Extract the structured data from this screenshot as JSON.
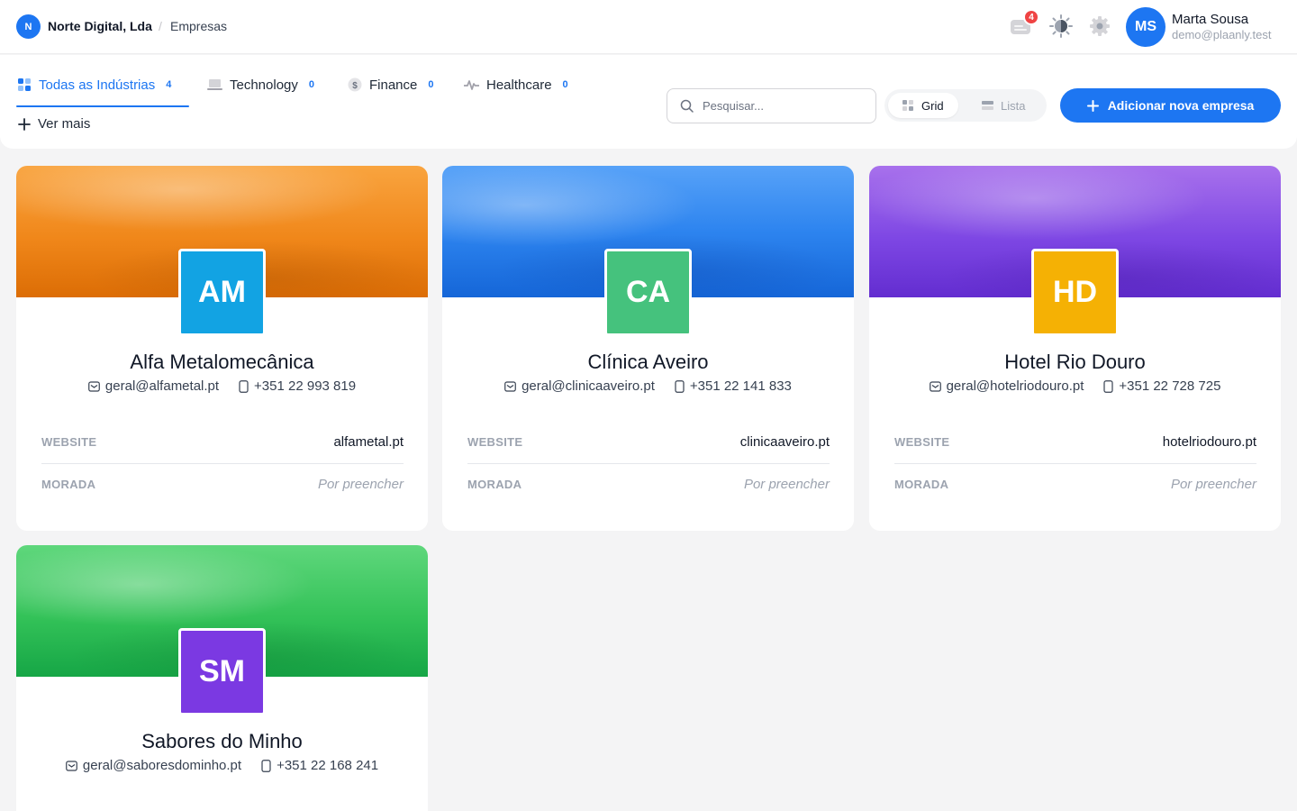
{
  "header": {
    "org_initial": "N",
    "org_name": "Norte Digital, Lda",
    "separator": "/",
    "page": "Empresas",
    "notification_count": "4",
    "user": {
      "initials": "MS",
      "name": "Marta Sousa",
      "email": "demo@plaanly.test"
    }
  },
  "filters": {
    "tabs": [
      {
        "label": "Todas as Indústrias",
        "count": "4",
        "icon": "grid-icon"
      },
      {
        "label": "Technology",
        "count": "0",
        "icon": "laptop-icon"
      },
      {
        "label": "Finance",
        "count": "0",
        "icon": "dollar-icon"
      },
      {
        "label": "Healthcare",
        "count": "0",
        "icon": "pulse-icon"
      }
    ],
    "more_label": "Ver mais",
    "search_placeholder": "Pesquisar...",
    "view_grid": "Grid",
    "view_list": "Lista",
    "add_label": "Adicionar nova empresa"
  },
  "companies": [
    {
      "initials": "AM",
      "name": "Alfa Metalomecânica",
      "email": "geral@alfametal.pt",
      "phone": "+351 22 993 819",
      "website": "alfametal.pt",
      "address": "Por preencher",
      "logo_color": "#12a3e3",
      "cover_color": "#f0871a"
    },
    {
      "initials": "CA",
      "name": "Clínica Aveiro",
      "email": "geral@clinicaaveiro.pt",
      "phone": "+351 22 141 833",
      "website": "clinicaaveiro.pt",
      "address": "Por preencher",
      "logo_color": "#45c27d",
      "cover_color": "#2d84ef"
    },
    {
      "initials": "HD",
      "name": "Hotel Rio Douro",
      "email": "geral@hotelriodouro.pt",
      "phone": "+351 22 728 725",
      "website": "hotelriodouro.pt",
      "address": "Por preencher",
      "logo_color": "#f5b104",
      "cover_color": "#7e47e4"
    },
    {
      "initials": "SM",
      "name": "Sabores do Minho",
      "email": "geral@saboresdominho.pt",
      "phone": "+351 22 168 241",
      "website": "",
      "address": "",
      "logo_color": "#7b39e2",
      "cover_color": "#33c258"
    }
  ],
  "labels": {
    "website": "WEBSITE",
    "address": "MORADA"
  },
  "colors": {
    "accent": "#1d76f2",
    "badge": "#ef4444"
  }
}
